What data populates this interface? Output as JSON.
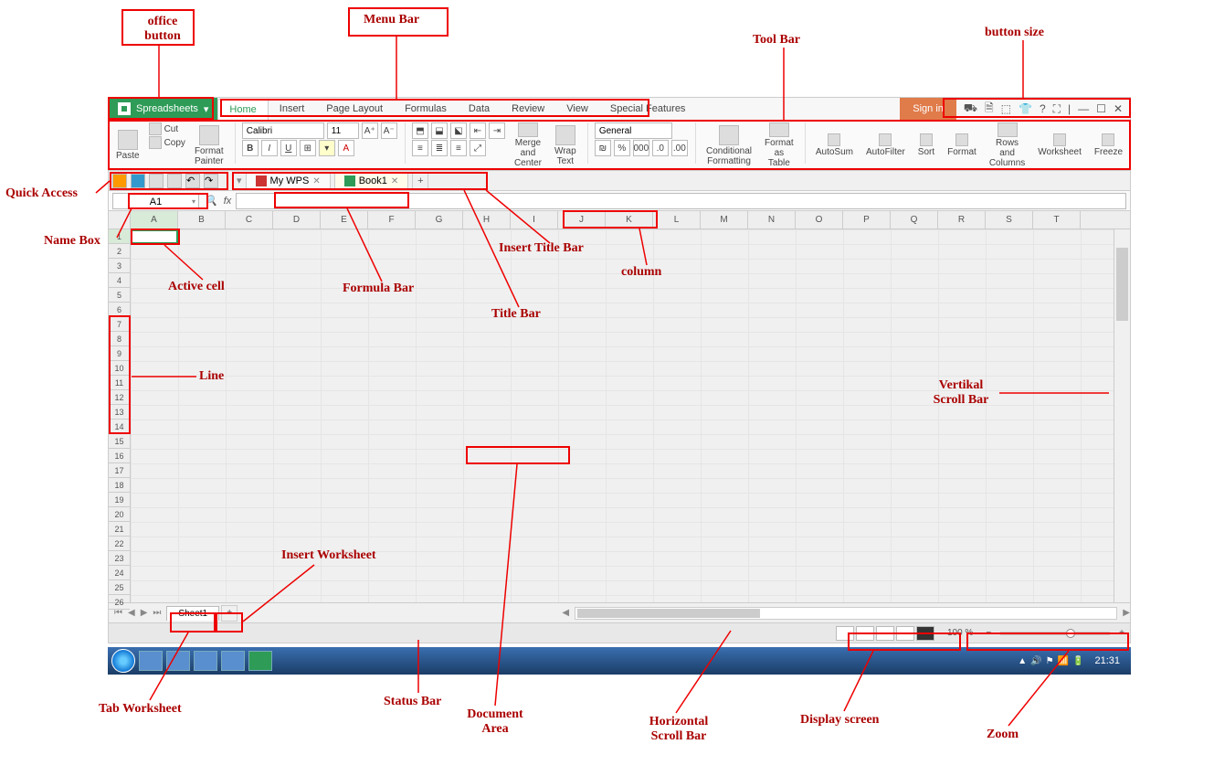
{
  "office_button": "Spreadsheets",
  "menu": [
    "Home",
    "Insert",
    "Page Layout",
    "Formulas",
    "Data",
    "Review",
    "View",
    "Special Features"
  ],
  "active_menu": 0,
  "signin": "Sign in",
  "winbtns": {
    "cart": "⛟",
    "doc": "🗎",
    "av": "⬚",
    "tt": "👕",
    "help": "?",
    "full": "⛶",
    "sep": "|",
    "min": "—",
    "max": "☐",
    "close": "✕"
  },
  "ribbon": {
    "paste": "Paste",
    "cut": "Cut",
    "copy": "Copy",
    "painter": "Format Painter",
    "font": "Calibri",
    "size": "11",
    "aplus": "A",
    "aminus": "A",
    "bold": "B",
    "italic": "I",
    "underline": "U",
    "merge": "Merge and Center",
    "wrap": "Wrap Text",
    "numfmt": "General",
    "condfmt": "Conditional Formatting",
    "fmt_table": "Format as Table",
    "autosum": "AutoSum",
    "autofilter": "AutoFilter",
    "sort": "Sort",
    "format": "Format",
    "rowscols": "Rows and Columns",
    "worksheet": "Worksheet",
    "freeze": "Freeze"
  },
  "qa_tabs": [
    {
      "label": "My WPS",
      "active": false
    },
    {
      "label": "Book1",
      "active": true
    }
  ],
  "namebox": "A1",
  "formula": "",
  "columns": [
    "A",
    "B",
    "C",
    "D",
    "E",
    "F",
    "G",
    "H",
    "I",
    "J",
    "K",
    "L",
    "M",
    "N",
    "O",
    "P",
    "Q",
    "R",
    "S",
    "T"
  ],
  "rows": 26,
  "active_col": "A",
  "active_row": 1,
  "sheet_tab": "Sheet1",
  "zoom": "100 %",
  "clock": "21:31",
  "annotations": {
    "office_button": "office button",
    "menu_bar": "Menu Bar",
    "tool_bar": "Tool Bar",
    "button_size": "button size",
    "quick_access": "Quick Access",
    "name_box": "Name Box",
    "active_cell": "Active cell",
    "formula_bar": "Formula Bar",
    "insert_title": "Insert Title Bar",
    "title_bar": "Title Bar",
    "column": "column",
    "line": "Line",
    "vscroll": "Vertikal Scroll Bar",
    "insert_ws": "Insert Worksheet",
    "tab_ws": "Tab Worksheet",
    "status_bar": "Status Bar",
    "doc_area": "Document Area",
    "hscroll": "Horizontal Scroll Bar",
    "display": "Display screen",
    "zoom": "Zoom"
  }
}
